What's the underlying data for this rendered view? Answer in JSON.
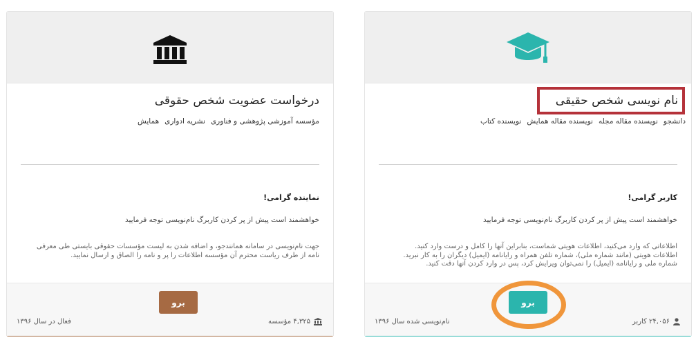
{
  "individual_card": {
    "title": "نام نویسی شخص حقیقی",
    "tags": [
      "دانشجو",
      "نویسنده مقاله مجله",
      "نویسنده مقاله همایش",
      "نویسنده کتاب"
    ],
    "greeting": "کاربر گرامی!",
    "intro": "خواهشمند است پیش از پر کردن کاربرگ نام‌نویسی توجه فرمایید",
    "body_lines": [
      "اطلاعاتی که وارد می‌کنید، اطلاعات هویتی شماست، بنابراین آنها را کامل و درست وارد کنید.",
      "اطلاعات هویتی (مانند شماره ملی)، شماره تلفن همراه و رایانامه (ایمیل) دیگران را به کار نبرید.",
      "شماره ملی و رایانامه (ایمیل) را نمی‌توان ویرایش کرد، پس در وارد کردن آنها دقت کنید."
    ],
    "button_label": "برو",
    "count_label": "۲۴,۰۵۶ کاربر",
    "since_label": "نام‌نویسی شده سال ۱۳۹۶",
    "count_icon": "user-icon",
    "header_icon": "graduation-cap-icon",
    "accent_color": "#2bb5ad"
  },
  "legal_card": {
    "title": "درخواست عضویت شخص حقوقی",
    "tags": [
      "مؤسسه آموزشی پژوهشی و فناوری",
      "نشریه ادواری",
      "همایش"
    ],
    "greeting": "نماینده گرامی!",
    "intro": "خواهشمند است پیش از پر کردن کاربرگ نام‌نویسی توجه فرمایید",
    "body_lines": [
      "جهت نام‌نویسی در سامانه همانندجو، و اضافه شدن به لیست مؤسسات حقوقی بایستی طی معرفی",
      "نامه از طرف ریاست محترم آن مؤسسه اطلاعات را پر و نامه را الصاق و ارسال نمایید."
    ],
    "button_label": "برو",
    "count_label": "۴,۳۲۵ مؤسسه",
    "since_label": "فعال در سال ۱۳۹۶",
    "count_icon": "institution-icon",
    "header_icon": "institution-icon",
    "accent_color": "#a66a43"
  },
  "annotations": {
    "title_highlight_color": "#b5323a",
    "button_highlight_color": "#f0963b"
  }
}
